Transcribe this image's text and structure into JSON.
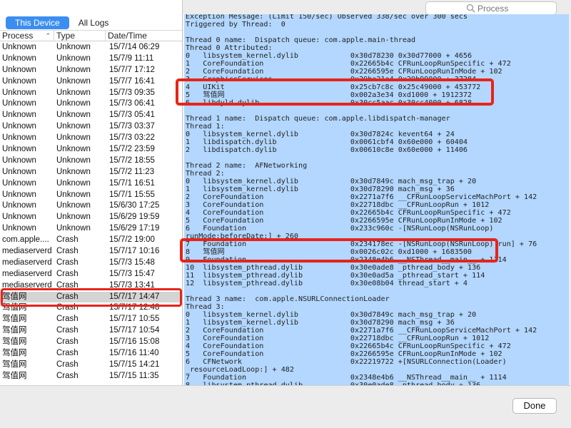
{
  "tabs": {
    "this_device": "This Device",
    "all_logs": "All Logs"
  },
  "search": {
    "placeholder": "Process"
  },
  "columns": {
    "process": "Process",
    "type": "Type",
    "date": "Date/Time"
  },
  "rows": [
    {
      "process": "Unknown",
      "type": "Unknown",
      "date": "15/7/14 06:29"
    },
    {
      "process": "Unknown",
      "type": "Unknown",
      "date": "15/7/9 11:11"
    },
    {
      "process": "Unknown",
      "type": "Unknown",
      "date": "15/7/7 17:12"
    },
    {
      "process": "Unknown",
      "type": "Unknown",
      "date": "15/7/7 16:41"
    },
    {
      "process": "Unknown",
      "type": "Unknown",
      "date": "15/7/3 09:35"
    },
    {
      "process": "Unknown",
      "type": "Unknown",
      "date": "15/7/3 06:41"
    },
    {
      "process": "Unknown",
      "type": "Unknown",
      "date": "15/7/3 05:41"
    },
    {
      "process": "Unknown",
      "type": "Unknown",
      "date": "15/7/3 03:37"
    },
    {
      "process": "Unknown",
      "type": "Unknown",
      "date": "15/7/3 03:22"
    },
    {
      "process": "Unknown",
      "type": "Unknown",
      "date": "15/7/2 23:59"
    },
    {
      "process": "Unknown",
      "type": "Unknown",
      "date": "15/7/2 18:55"
    },
    {
      "process": "Unknown",
      "type": "Unknown",
      "date": "15/7/2 11:23"
    },
    {
      "process": "Unknown",
      "type": "Unknown",
      "date": "15/7/1 16:51"
    },
    {
      "process": "Unknown",
      "type": "Unknown",
      "date": "15/7/1 15:55"
    },
    {
      "process": "Unknown",
      "type": "Unknown",
      "date": "15/6/30 17:25"
    },
    {
      "process": "Unknown",
      "type": "Unknown",
      "date": "15/6/29 19:59"
    },
    {
      "process": "Unknown",
      "type": "Unknown",
      "date": "15/6/29 17:19"
    },
    {
      "process": "com.apple....",
      "type": "Crash",
      "date": "15/7/2 19:00"
    },
    {
      "process": "mediaserverd",
      "type": "Crash",
      "date": "15/7/17 10:16"
    },
    {
      "process": "mediaserverd",
      "type": "Crash",
      "date": "15/7/3 15:48"
    },
    {
      "process": "mediaserverd",
      "type": "Crash",
      "date": "15/7/3 15:47"
    },
    {
      "process": "mediaserverd",
      "type": "Crash",
      "date": "15/7/3 13:41"
    },
    {
      "process": "驾值网",
      "type": "Crash",
      "date": "15/7/17 14:47"
    },
    {
      "process": "驾值网",
      "type": "Crash",
      "date": "15/7/17 12:48"
    },
    {
      "process": "驾值网",
      "type": "Crash",
      "date": "15/7/17 10:55"
    },
    {
      "process": "驾值网",
      "type": "Crash",
      "date": "15/7/17 10:54"
    },
    {
      "process": "驾值网",
      "type": "Crash",
      "date": "15/7/16 15:08"
    },
    {
      "process": "驾值网",
      "type": "Crash",
      "date": "15/7/16 11:40"
    },
    {
      "process": "驾值网",
      "type": "Crash",
      "date": "15/7/15 14:21"
    },
    {
      "process": "驾值网",
      "type": "Crash",
      "date": "15/7/15 11:35"
    }
  ],
  "log_text": "Exception Message: (Limit 150/sec) Observed 338/sec over 300 secs\nTriggered by Thread:  0\n\nThread 0 name:  Dispatch queue: com.apple.main-thread\nThread 0 Attributed:\n0   libsystem_kernel.dylib            0x30d78230 0x30d77000 + 4656\n1   CoreFoundation                    0x22665b4c CFRunLoopRunSpecific + 472\n2   CoreFoundation                    0x2266595e CFRunLoopRunInMode + 102\n3   GraphicsServices                  0x29ba21a4 0x29b99000 + 37284\n4   UIKit                             0x25cb7c8c 0x25c49000 + 453772\n5   驾值网                             0x002a3e34 0xd1000 + 1912372\n6   libdyld.dylib                     0x30cc5aac 0x30cc4000 + 6828\n\nThread 1 name:  Dispatch queue: com.apple.libdispatch-manager\nThread 1:\n0   libsystem_kernel.dylib            0x30d7824c kevent64 + 24\n1   libdispatch.dylib                 0x0061cbf4 0x60e000 + 60404\n2   libdispatch.dylib                 0x00610c8e 0x60e000 + 11406\n\nThread 2 name:  AFNetworking\nThread 2:\n0   libsystem_kernel.dylib            0x30d7849c mach_msg_trap + 20\n1   libsystem_kernel.dylib            0x30d78290 mach_msg + 36\n2   CoreFoundation                    0x2271a7f6 __CFRunLoopServiceMachPort + 142\n3   CoreFoundation                    0x22718dbc __CFRunLoopRun + 1012\n4   CoreFoundation                    0x22665b4c CFRunLoopRunSpecific + 472\n5   CoreFoundation                    0x2266595e CFRunLoopRunInMode + 102\n6   Foundation                        0x233c960c -[NSRunLoop(NSRunLoop)\nrunMode:beforeDate:] + 260\n7   Foundation                        0x234178ec -[NSRunLoop(NSRunLoop) run] + 76\n8   驾值网                             0x0026c02c 0xd1000 + 1683500\n9   Foundation                        0x2348e4b6 __NSThread__main__ + 1114\n10  libsystem_pthread.dylib           0x30e0ade8 _pthread_body + 136\n11  libsystem_pthread.dylib           0x30e0ad5a _pthread_start + 114\n12  libsystem_pthread.dylib           0x30e08b04 thread_start + 4\n\nThread 3 name:  com.apple.NSURLConnectionLoader\nThread 3:\n0   libsystem_kernel.dylib            0x30d7849c mach_msg_trap + 20\n1   libsystem_kernel.dylib            0x30d78290 mach_msg + 36\n2   CoreFoundation                    0x2271a7f6 __CFRunLoopServiceMachPort + 142\n3   CoreFoundation                    0x22718dbc __CFRunLoopRun + 1012\n4   CoreFoundation                    0x22665b4c CFRunLoopRunSpecific + 472\n5   CoreFoundation                    0x2266595e CFRunLoopRunInMode + 102\n6   CFNetwork                         0x22219722 +[NSURLConnection(Loader)\n_resourceLoadLoop:] + 482\n7   Foundation                        0x2348e4b6 __NSThread__main__ + 1114\n8   libsystem_pthread.dylib           0x30e0ade8 _pthread_body + 136",
  "done_label": "Done",
  "colors": {
    "accent": "#3b8ef0",
    "highlight_red": "#e8231a",
    "selection_blue": "#b3d7ff"
  }
}
